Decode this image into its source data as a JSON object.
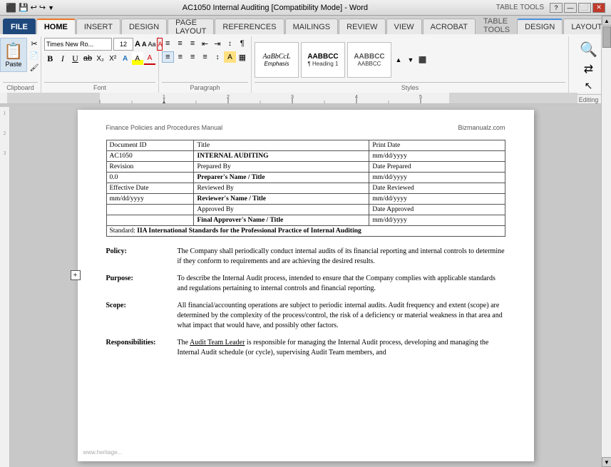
{
  "titlebar": {
    "title": "AC1050 Internal Auditing [Compatibility Mode] - Word",
    "section": "TABLE TOOLS",
    "left_icons": [
      "⬛",
      "💾",
      "↩",
      "↪",
      "▼"
    ],
    "win_controls": [
      "?",
      "—",
      "⬜",
      "✕"
    ]
  },
  "tabs": {
    "items": [
      "FILE",
      "HOME",
      "INSERT",
      "DESIGN",
      "PAGE LAYOUT",
      "REFERENCES",
      "MAILINGS",
      "REVIEW",
      "VIEW",
      "ACROBAT",
      "DESIGN",
      "LAYOUT"
    ],
    "active": "HOME",
    "table_tools": "TABLE TOOLS"
  },
  "ribbon": {
    "clipboard": {
      "paste_label": "Paste",
      "group_label": "Clipboard"
    },
    "font": {
      "name": "Times New Ro...",
      "size": "12",
      "buttons": [
        "A",
        "A",
        "Aa",
        "A"
      ],
      "format": [
        "B",
        "I",
        "U",
        "ab",
        "X₂",
        "X²",
        "A",
        "A"
      ],
      "group_label": "Font"
    },
    "paragraph": {
      "group_label": "Paragraph"
    },
    "styles": {
      "items": [
        {
          "label": "Emphasis",
          "preview_text": "AaBbCcL"
        },
        {
          "label": "¶ Heading 1",
          "preview_text": "AABBCC"
        },
        {
          "label": "AABBCC",
          "preview_text": "AABBCC"
        }
      ],
      "group_label": "Styles"
    },
    "editing": {
      "label": "Editing"
    }
  },
  "ruler": {
    "markers": [
      1,
      2,
      3,
      4,
      5
    ]
  },
  "document": {
    "header_left": "Finance Policies and Procedures Manual",
    "header_right": "Bizmanualz.com",
    "table": {
      "rows": [
        [
          "Document ID",
          "Title",
          "Print Date"
        ],
        [
          "AC1050",
          "INTERNAL AUDITING",
          "mm/dd/yyyy"
        ],
        [
          "Revision",
          "Prepared By",
          "Date Prepared"
        ],
        [
          "0.0",
          "Preparer's Name / Title",
          "mm/dd/yyyy"
        ],
        [
          "Effective Date",
          "Reviewed By",
          "Date Reviewed"
        ],
        [
          "mm/dd/yyyy",
          "Reviewer's Name / Title",
          "mm/dd/yyyy"
        ],
        [
          "",
          "Approved By",
          "Date Approved"
        ],
        [
          "",
          "Final Approver's Name / Title",
          "mm/dd/yyyy"
        ]
      ],
      "standard_row": "Standard: IIA International Standards for the Professional Practice of Internal Auditing"
    },
    "sections": [
      {
        "label": "Policy:",
        "content": "The Company shall periodically conduct internal audits of its financial reporting and internal controls to determine if they conform to requirements and are achieving the desired results."
      },
      {
        "label": "Purpose:",
        "content": "To describe the Internal Audit process, intended to ensure that the Company complies with applicable standards and regulations pertaining to internal controls and financial reporting."
      },
      {
        "label": "Scope:",
        "content": "All financial/accounting operations are subject to periodic internal audits. Audit frequency and extent (scope) are determined by the complexity of the process/control, the risk of a deficiency or material weakness in that area and what impact that would have, and possibly other factors."
      },
      {
        "label": "Responsibilities:",
        "content": "The Audit Team Leader is responsible for managing the Internal Audit process, developing and managing the Internal Audit schedule (or cycle), supervising Audit Team members, and"
      }
    ],
    "watermark": "www.heritage..."
  }
}
